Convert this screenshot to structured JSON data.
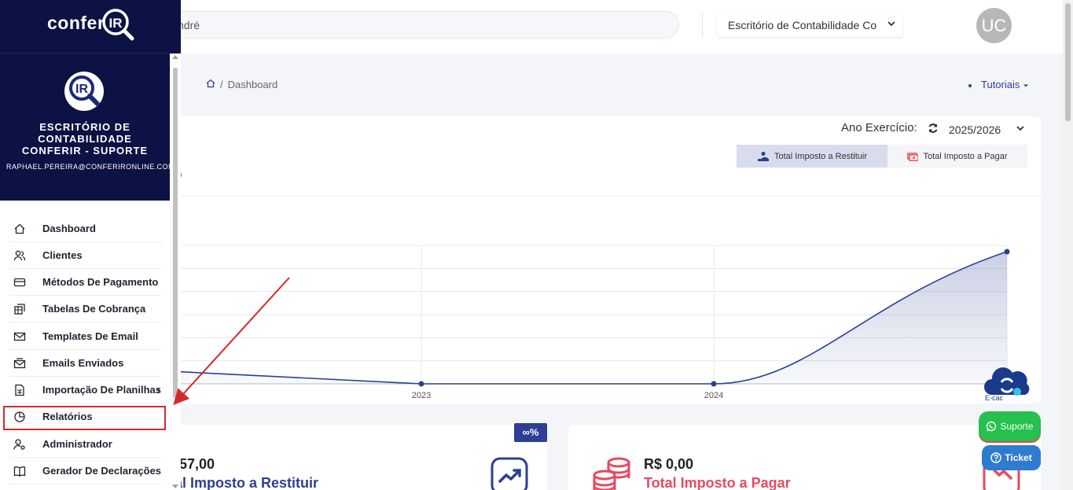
{
  "header": {
    "search_text": "ndré",
    "company_select": "Escritório de Contabilidade Co",
    "avatar_initials": "UC"
  },
  "sidebar": {
    "logo_text": "confer",
    "logo_mark": "IR",
    "org_name": "ESCRITÓRIO DE CONTABILIDADE CONFERIR - SUPORTE",
    "org_email": "RAPHAEL.PEREIRA@CONFERIRONLINE.COM.BR",
    "items": [
      {
        "label": "Dashboard",
        "icon": "home-icon"
      },
      {
        "label": "Clientes",
        "icon": "users-icon"
      },
      {
        "label": "Métodos De Pagamento",
        "icon": "credit-card-icon"
      },
      {
        "label": "Tabelas De Cobrança",
        "icon": "table-icon"
      },
      {
        "label": "Templates De Email",
        "icon": "mail-icon"
      },
      {
        "label": "Emails Enviados",
        "icon": "mail-sent-icon"
      },
      {
        "label": "Importação De Planilhas",
        "icon": "spreadsheet-icon"
      },
      {
        "label": "Relatórios",
        "icon": "pie-chart-icon"
      },
      {
        "label": "Administrador",
        "icon": "user-cog-icon"
      },
      {
        "label": "Gerador De Declarações",
        "icon": "book-icon"
      }
    ]
  },
  "breadcrumb": {
    "paren": ")",
    "separator": "/",
    "current": "Dashboard"
  },
  "tutoriais": "Tutoriais",
  "chart_card": {
    "ano_label": "Ano Exercício:",
    "ano_value": "2025/2026",
    "tab_restituir": "Total Imposto a Restituir",
    "tab_pagar": "Total Imposto a Pagar",
    "title_fragment": "o"
  },
  "chart_data": {
    "type": "area",
    "x": [
      "",
      "2023",
      "2024",
      ""
    ],
    "xticks": [
      "2023",
      "2024"
    ],
    "values": [
      0.1,
      0.0,
      0.0,
      1.0
    ],
    "grid": true,
    "legend": "none",
    "color": "#2c3f95"
  },
  "stats": {
    "left": {
      "badge": "∞%",
      "value": "57,00",
      "label": "al Imposto a Restituir",
      "color": "#2c3f95"
    },
    "right": {
      "value": "R$ 0,00",
      "label": "Total Imposto a Pagar",
      "color": "#e84a5f"
    }
  },
  "widgets": {
    "ecac_label": "E-cac",
    "suporte": "Suporte",
    "ticket": "Ticket"
  },
  "colors": {
    "sidebar_bg": "#0d1244",
    "accent": "#2c3f95",
    "danger": "#e84a5f",
    "whatsapp": "#25c04d",
    "highlight": "#d42a2a"
  }
}
